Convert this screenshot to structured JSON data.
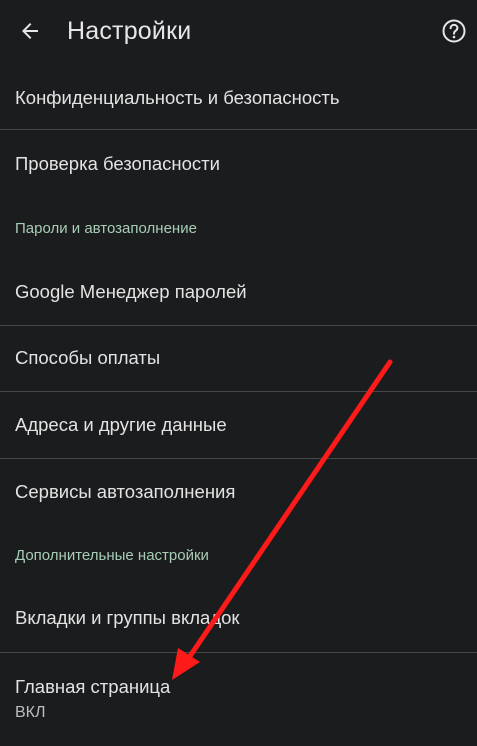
{
  "app_bar": {
    "title": "Настройки",
    "back_icon": "arrow-back-icon",
    "help_icon": "help-circle-icon"
  },
  "items": {
    "privacy": {
      "title": "Конфиденциальность и безопасность"
    },
    "safety_check": {
      "title": "Проверка безопасности"
    },
    "passwords_header": "Пароли и автозаполнение",
    "password_manager": {
      "title": "Google Менеджер паролей"
    },
    "payment_methods": {
      "title": "Способы оплаты"
    },
    "addresses": {
      "title": "Адреса и другие данные"
    },
    "autofill_services": {
      "title": "Сервисы автозаполнения"
    },
    "advanced_header": "Дополнительные настройки",
    "tabs_groups": {
      "title": "Вкладки и группы вкладок"
    },
    "homepage": {
      "title": "Главная страница",
      "subtitle": "ВКЛ"
    }
  },
  "colors": {
    "background": "#1b1c1e",
    "text": "#e3e3e3",
    "section_header": "#a8cdb5",
    "divider": "#44474b",
    "annotation_arrow": "#ff1a1a"
  }
}
